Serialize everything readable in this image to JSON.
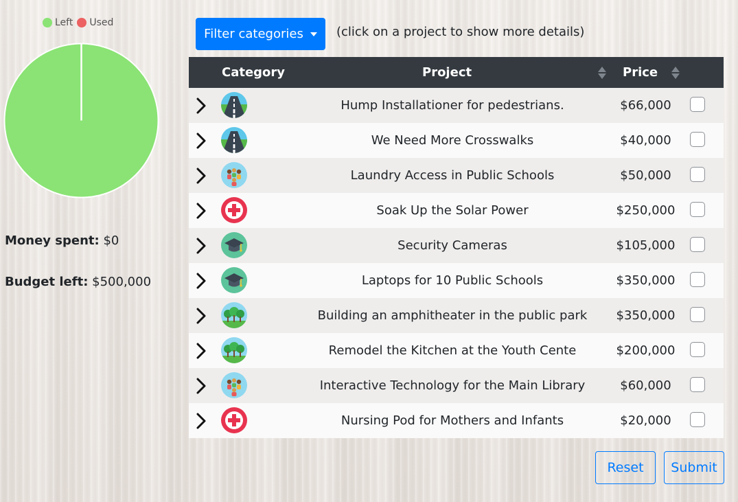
{
  "legend": [
    {
      "label": "Left",
      "color": "#8ae374"
    },
    {
      "label": "Used",
      "color": "#ec6161"
    }
  ],
  "budget": {
    "money_spent_label": "Money spent:",
    "money_spent_value": "$0",
    "budget_left_label": "Budget left:",
    "budget_left_value": "$500,000",
    "used_fraction": 0.0
  },
  "toolbar": {
    "filter_label": "Filter categories",
    "hint": "(click on a project to show more details)"
  },
  "table": {
    "headers": {
      "category": "Category",
      "project": "Project",
      "price": "Price"
    },
    "rows": [
      {
        "icon": "road-icon",
        "project": "Hump Installationer for pedestrians.",
        "price": "$66,000",
        "checked": false
      },
      {
        "icon": "road-icon",
        "project": "We Need More Crosswalks",
        "price": "$40,000",
        "checked": false
      },
      {
        "icon": "community-icon",
        "project": "Laundry Access in Public Schools",
        "price": "$50,000",
        "checked": false
      },
      {
        "icon": "health-cross-icon",
        "project": "Soak Up the Solar Power",
        "price": "$250,000",
        "checked": false
      },
      {
        "icon": "education-cap-icon",
        "project": "Security Cameras",
        "price": "$105,000",
        "checked": false
      },
      {
        "icon": "education-cap-icon",
        "project": "Laptops for 10 Public Schools",
        "price": "$350,000",
        "checked": false
      },
      {
        "icon": "park-trees-icon",
        "project": "Building an amphitheater in the public park",
        "price": "$350,000",
        "checked": false
      },
      {
        "icon": "park-trees-icon",
        "project": "Remodel the Kitchen at the Youth Cente",
        "price": "$200,000",
        "checked": false
      },
      {
        "icon": "community-icon",
        "project": "Interactive Technology for the Main Library",
        "price": "$60,000",
        "checked": false
      },
      {
        "icon": "health-cross-icon",
        "project": "Nursing Pod for Mothers and Infants",
        "price": "$20,000",
        "checked": false
      }
    ]
  },
  "actions": {
    "reset_label": "Reset",
    "submit_label": "Submit"
  }
}
